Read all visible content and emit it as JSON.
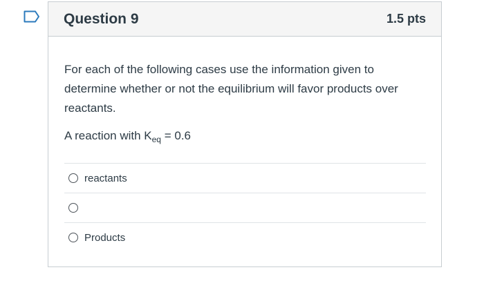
{
  "question": {
    "title": "Question 9",
    "points": "1.5 pts",
    "prompt": "For each of the following cases use the information given to determine whether or not the equilibrium will favor products over reactants.",
    "reaction_prefix": "A reaction with K",
    "reaction_subscript": "eq",
    "reaction_suffix": " = 0.6"
  },
  "answers": [
    {
      "label": "reactants"
    },
    {
      "label": ""
    },
    {
      "label": "Products"
    }
  ]
}
